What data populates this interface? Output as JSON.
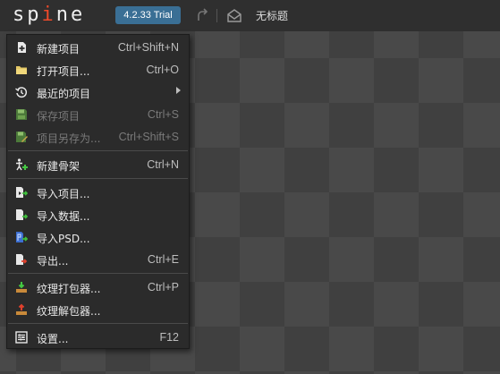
{
  "app": {
    "logo_text": "spine",
    "version_badge": "4.2.33 Trial",
    "document_title": "无标题"
  },
  "menu": {
    "items": [
      {
        "label": "新建项目",
        "shortcut": "Ctrl+Shift+N",
        "icon": "new-project-icon"
      },
      {
        "label": "打开项目...",
        "shortcut": "Ctrl+O",
        "icon": "folder-icon"
      },
      {
        "label": "最近的项目",
        "shortcut": "",
        "icon": "history-icon",
        "submenu": true
      },
      {
        "label": "保存项目",
        "shortcut": "Ctrl+S",
        "icon": "save-icon",
        "disabled": true
      },
      {
        "label": "项目另存为...",
        "shortcut": "Ctrl+Shift+S",
        "icon": "save-as-icon",
        "disabled": true
      },
      {
        "label": "新建骨架",
        "shortcut": "Ctrl+N",
        "icon": "new-skeleton-icon"
      },
      {
        "label": "导入项目...",
        "shortcut": "",
        "icon": "import-project-icon"
      },
      {
        "label": "导入数据...",
        "shortcut": "",
        "icon": "import-data-icon"
      },
      {
        "label": "导入PSD...",
        "shortcut": "",
        "icon": "import-psd-icon"
      },
      {
        "label": "导出...",
        "shortcut": "Ctrl+E",
        "icon": "export-icon"
      },
      {
        "label": "纹理打包器...",
        "shortcut": "Ctrl+P",
        "icon": "texture-pack-icon"
      },
      {
        "label": "纹理解包器...",
        "shortcut": "",
        "icon": "texture-unpack-icon"
      },
      {
        "label": "设置...",
        "shortcut": "F12",
        "icon": "settings-icon"
      }
    ]
  }
}
